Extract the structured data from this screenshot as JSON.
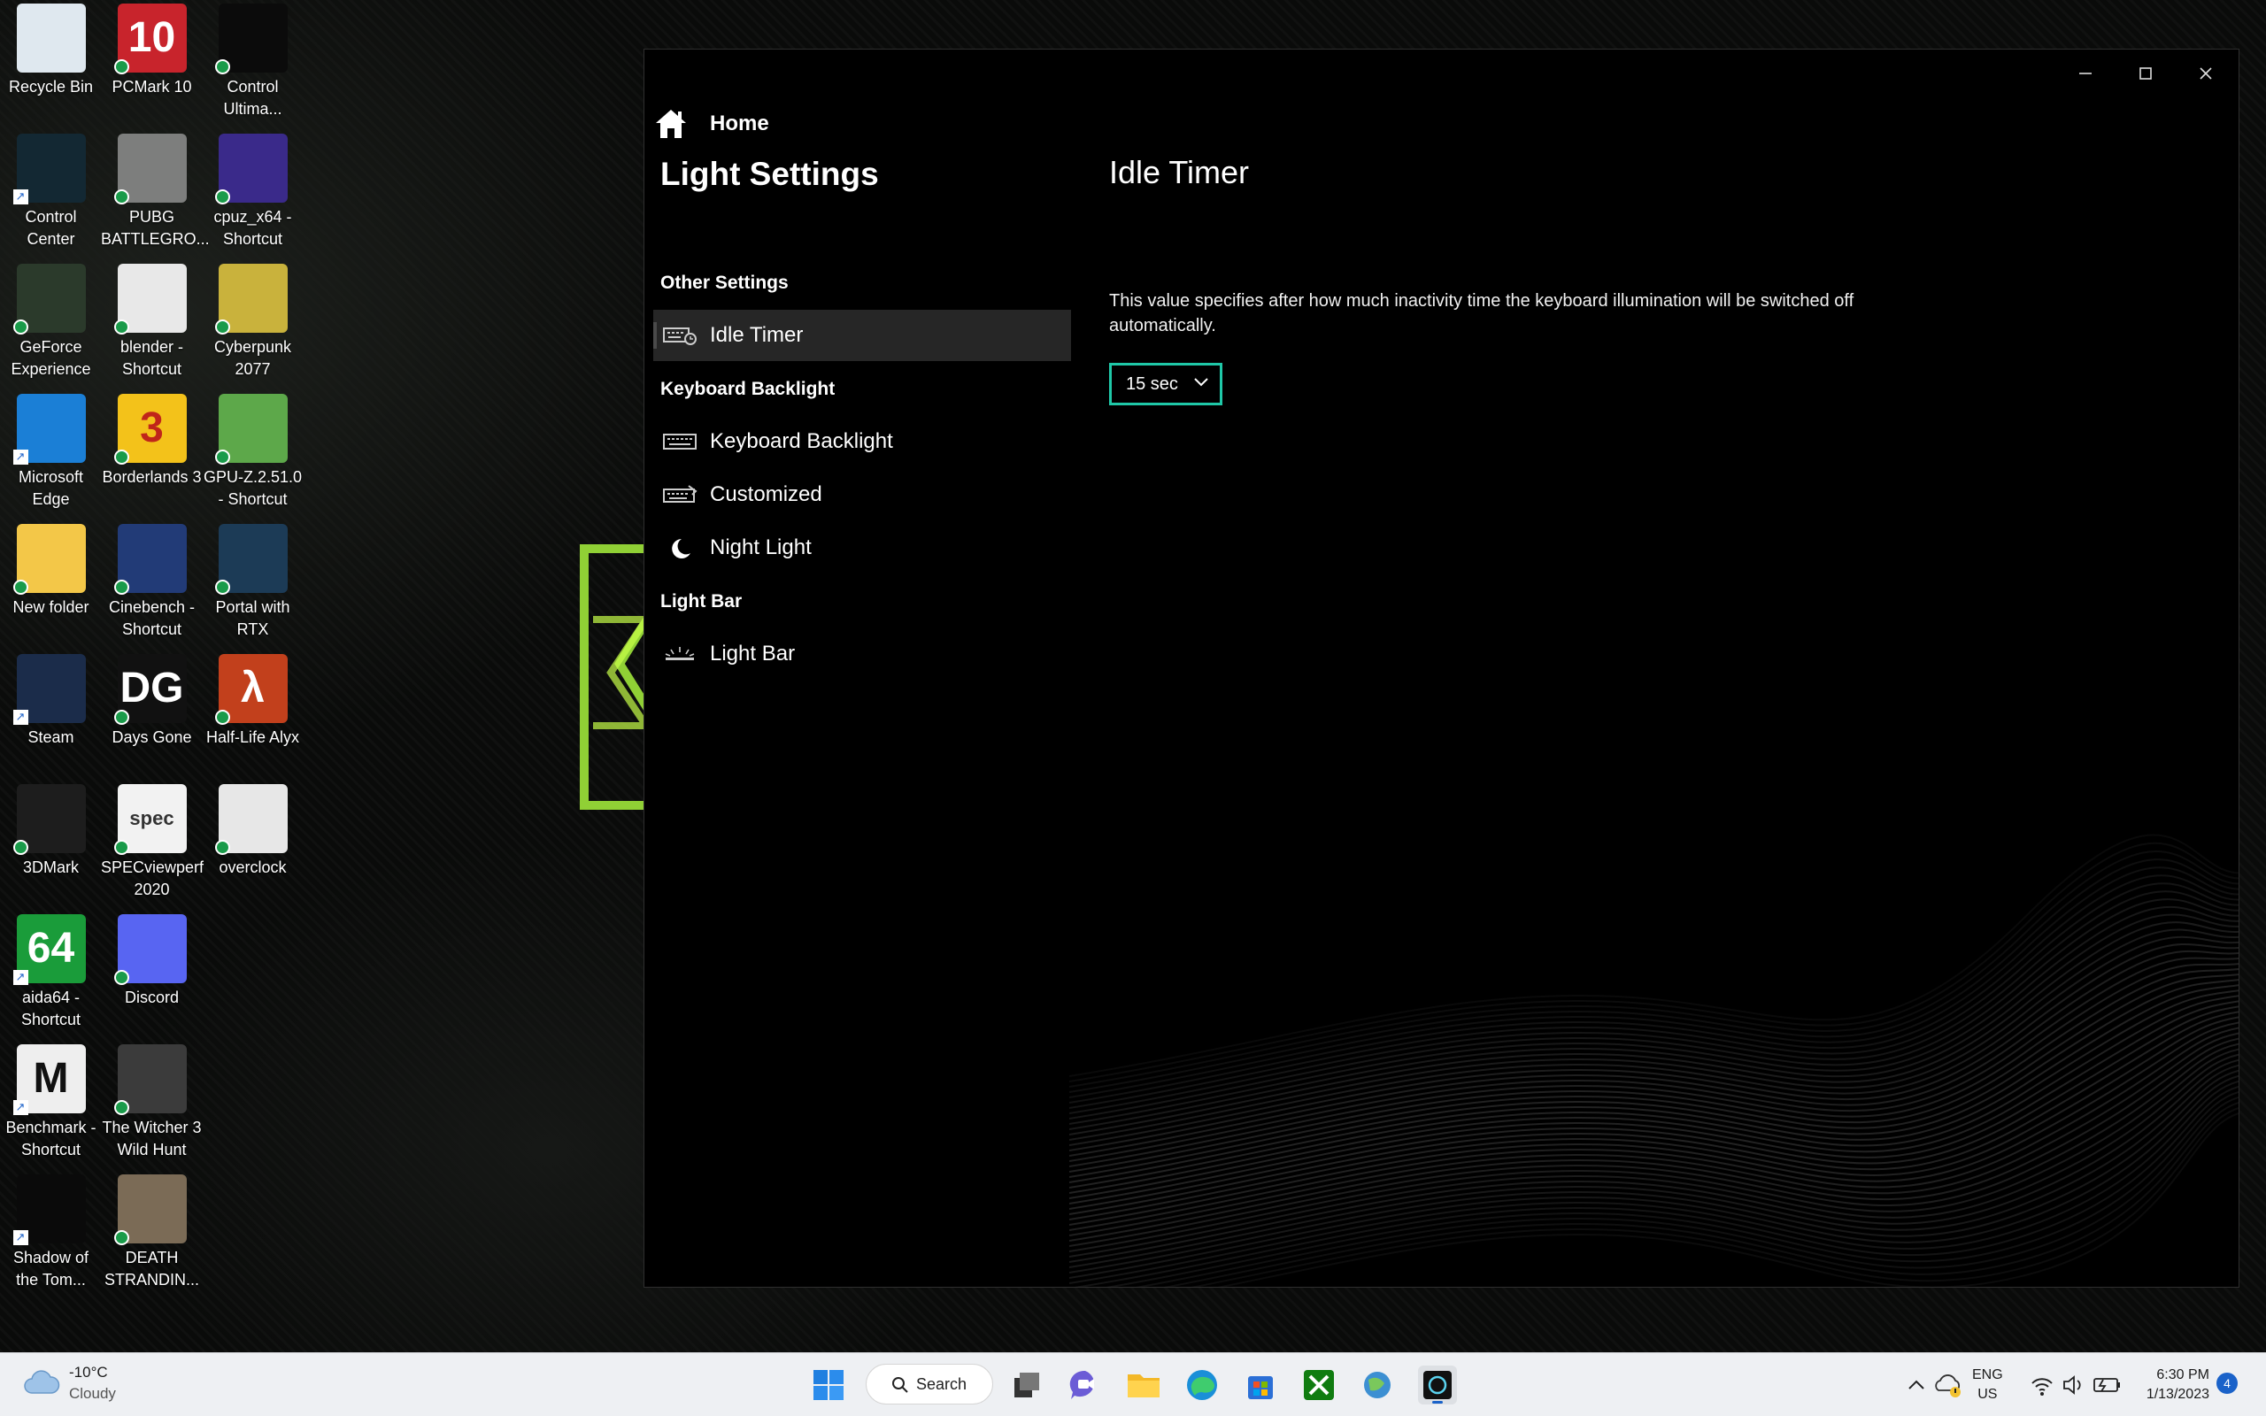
{
  "desktop": {
    "icons": [
      {
        "label": "Recycle Bin",
        "icon": "recycle-bin-icon"
      },
      {
        "label": "PCMark 10",
        "icon": "pcmark-icon",
        "glyph": "10"
      },
      {
        "label": "Control Ultima...",
        "icon": "control-ultima-icon"
      },
      {
        "label": "Control Center",
        "icon": "control-center-icon"
      },
      {
        "label": "PUBG BATTLEGRO...",
        "icon": "pubg-icon"
      },
      {
        "label": "cpuz_x64 - Shortcut",
        "icon": "cpuz-icon"
      },
      {
        "label": "GeForce Experience",
        "icon": "geforce-icon"
      },
      {
        "label": "blender - Shortcut",
        "icon": "blender-icon"
      },
      {
        "label": "Cyberpunk 2077",
        "icon": "cyberpunk-icon"
      },
      {
        "label": "Microsoft Edge",
        "icon": "edge-icon"
      },
      {
        "label": "Borderlands 3",
        "icon": "borderlands-icon",
        "glyph": "3"
      },
      {
        "label": "GPU-Z.2.51.0 - Shortcut",
        "icon": "gpuz-icon"
      },
      {
        "label": "New folder",
        "icon": "folder-icon"
      },
      {
        "label": "Cinebench - Shortcut",
        "icon": "cinebench-icon"
      },
      {
        "label": "Portal with RTX",
        "icon": "portal-icon"
      },
      {
        "label": "Steam",
        "icon": "steam-icon"
      },
      {
        "label": "Days Gone",
        "icon": "days-gone-icon",
        "glyph": "DG"
      },
      {
        "label": "Half-Life Alyx",
        "icon": "half-life-icon",
        "glyph": "λ"
      },
      {
        "label": "3DMark",
        "icon": "3dmark-icon"
      },
      {
        "label": "SPECviewperf 2020",
        "icon": "specviewperf-icon",
        "glyph": "spec"
      },
      {
        "label": "overclock",
        "icon": "overclock-icon"
      },
      {
        "label": "aida64 - Shortcut",
        "icon": "aida64-icon",
        "glyph": "64"
      },
      {
        "label": "Discord",
        "icon": "discord-icon"
      },
      {
        "label": "Benchmark - Shortcut",
        "icon": "benchmark-icon",
        "glyph": "M"
      },
      {
        "label": "The Witcher 3 Wild Hunt",
        "icon": "witcher-icon"
      },
      {
        "label": "Shadow of the Tom...",
        "icon": "shadow-tomb-raider-icon"
      },
      {
        "label": "DEATH STRANDIN...",
        "icon": "death-stranding-icon"
      }
    ]
  },
  "app": {
    "nav": {
      "home_label": "Home",
      "title": "Light Settings",
      "sections": {
        "other": "Other Settings",
        "keyboard": "Keyboard Backlight",
        "lightbar": "Light Bar"
      },
      "items": {
        "idle_timer": "Idle Timer",
        "keyboard_backlight": "Keyboard Backlight",
        "customized": "Customized",
        "night_light": "Night Light",
        "light_bar": "Light Bar"
      }
    },
    "content": {
      "title": "Idle Timer",
      "description": "This value specifies after how much inactivity time the keyboard illumination will be switched off automatically.",
      "timer_value": "15 sec"
    },
    "colors": {
      "accent": "#1fc8a8",
      "selected_bg": "#262626"
    }
  },
  "taskbar": {
    "weather_temp": "-10°C",
    "weather_desc": "Cloudy",
    "search_label": "Search",
    "lang_top": "ENG",
    "lang_bottom": "US",
    "time": "6:30 PM",
    "date": "1/13/2023",
    "notifications": "4"
  }
}
